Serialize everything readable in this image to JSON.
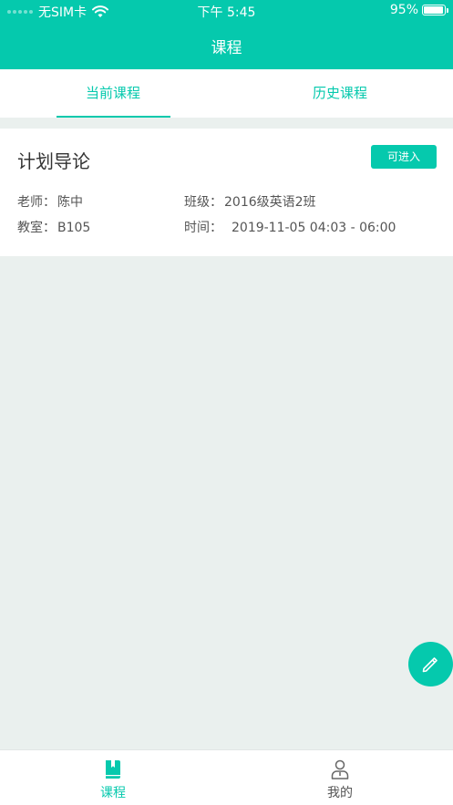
{
  "status_bar": {
    "carrier": "无SIM卡",
    "time": "下午 5:45",
    "battery": "95%",
    "battery_level": 0.95
  },
  "nav": {
    "title": "课程"
  },
  "tabs": [
    {
      "label": "当前课程",
      "active": true
    },
    {
      "label": "历史课程",
      "active": false
    }
  ],
  "course": {
    "name": "计划导论",
    "button": "可进入",
    "teacher_label": "老师：",
    "teacher": "陈中",
    "class_label": "班级：",
    "class": "2016级英语2班",
    "room_label": "教室：",
    "room": "B105",
    "time_label": "时间：",
    "time": "2019-11-05 04:03 - 06:00"
  },
  "tabbar": [
    {
      "label": "课程",
      "icon": "book-icon",
      "active": true
    },
    {
      "label": "我的",
      "icon": "person-icon",
      "active": false
    }
  ],
  "fab": {
    "icon": "pencil-icon"
  },
  "colors": {
    "accent": "#05c9ad",
    "background": "#eaf0ee"
  }
}
